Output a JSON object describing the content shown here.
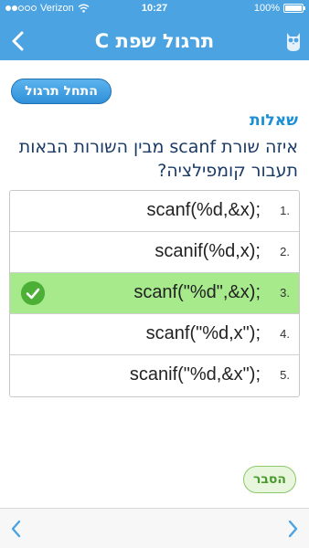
{
  "status": {
    "carrier": "Verizon",
    "time": "10:27",
    "battery": "100%"
  },
  "header": {
    "title": "תרגול שפת C"
  },
  "start_button_label": "התחל תרגול",
  "section_label": "שאלות",
  "question": "איזה שורת scanf מבין השורות הבאות תעבור קומפילציה?",
  "answers": [
    {
      "number": "1.",
      "code": "scanf(%d,&x);"
    },
    {
      "number": "2.",
      "code": "scanif(%d,x);"
    },
    {
      "number": "3.",
      "code": "scanf(\"%d\",&x);",
      "correct": true
    },
    {
      "number": "4.",
      "code": "scanf(\"%d,x\");"
    },
    {
      "number": "5.",
      "code": "scanif(\"%d,&x\");"
    }
  ],
  "explain_button_label": "הסבר",
  "colors": {
    "accent": "#4ba3e2",
    "correct": "#a7ea8c",
    "check": "#4caf36"
  },
  "icons": {
    "back": "chevron-left-icon",
    "owl": "owl-icon",
    "check": "check-icon",
    "prev": "chevron-left-icon",
    "next": "chevron-right-icon"
  }
}
